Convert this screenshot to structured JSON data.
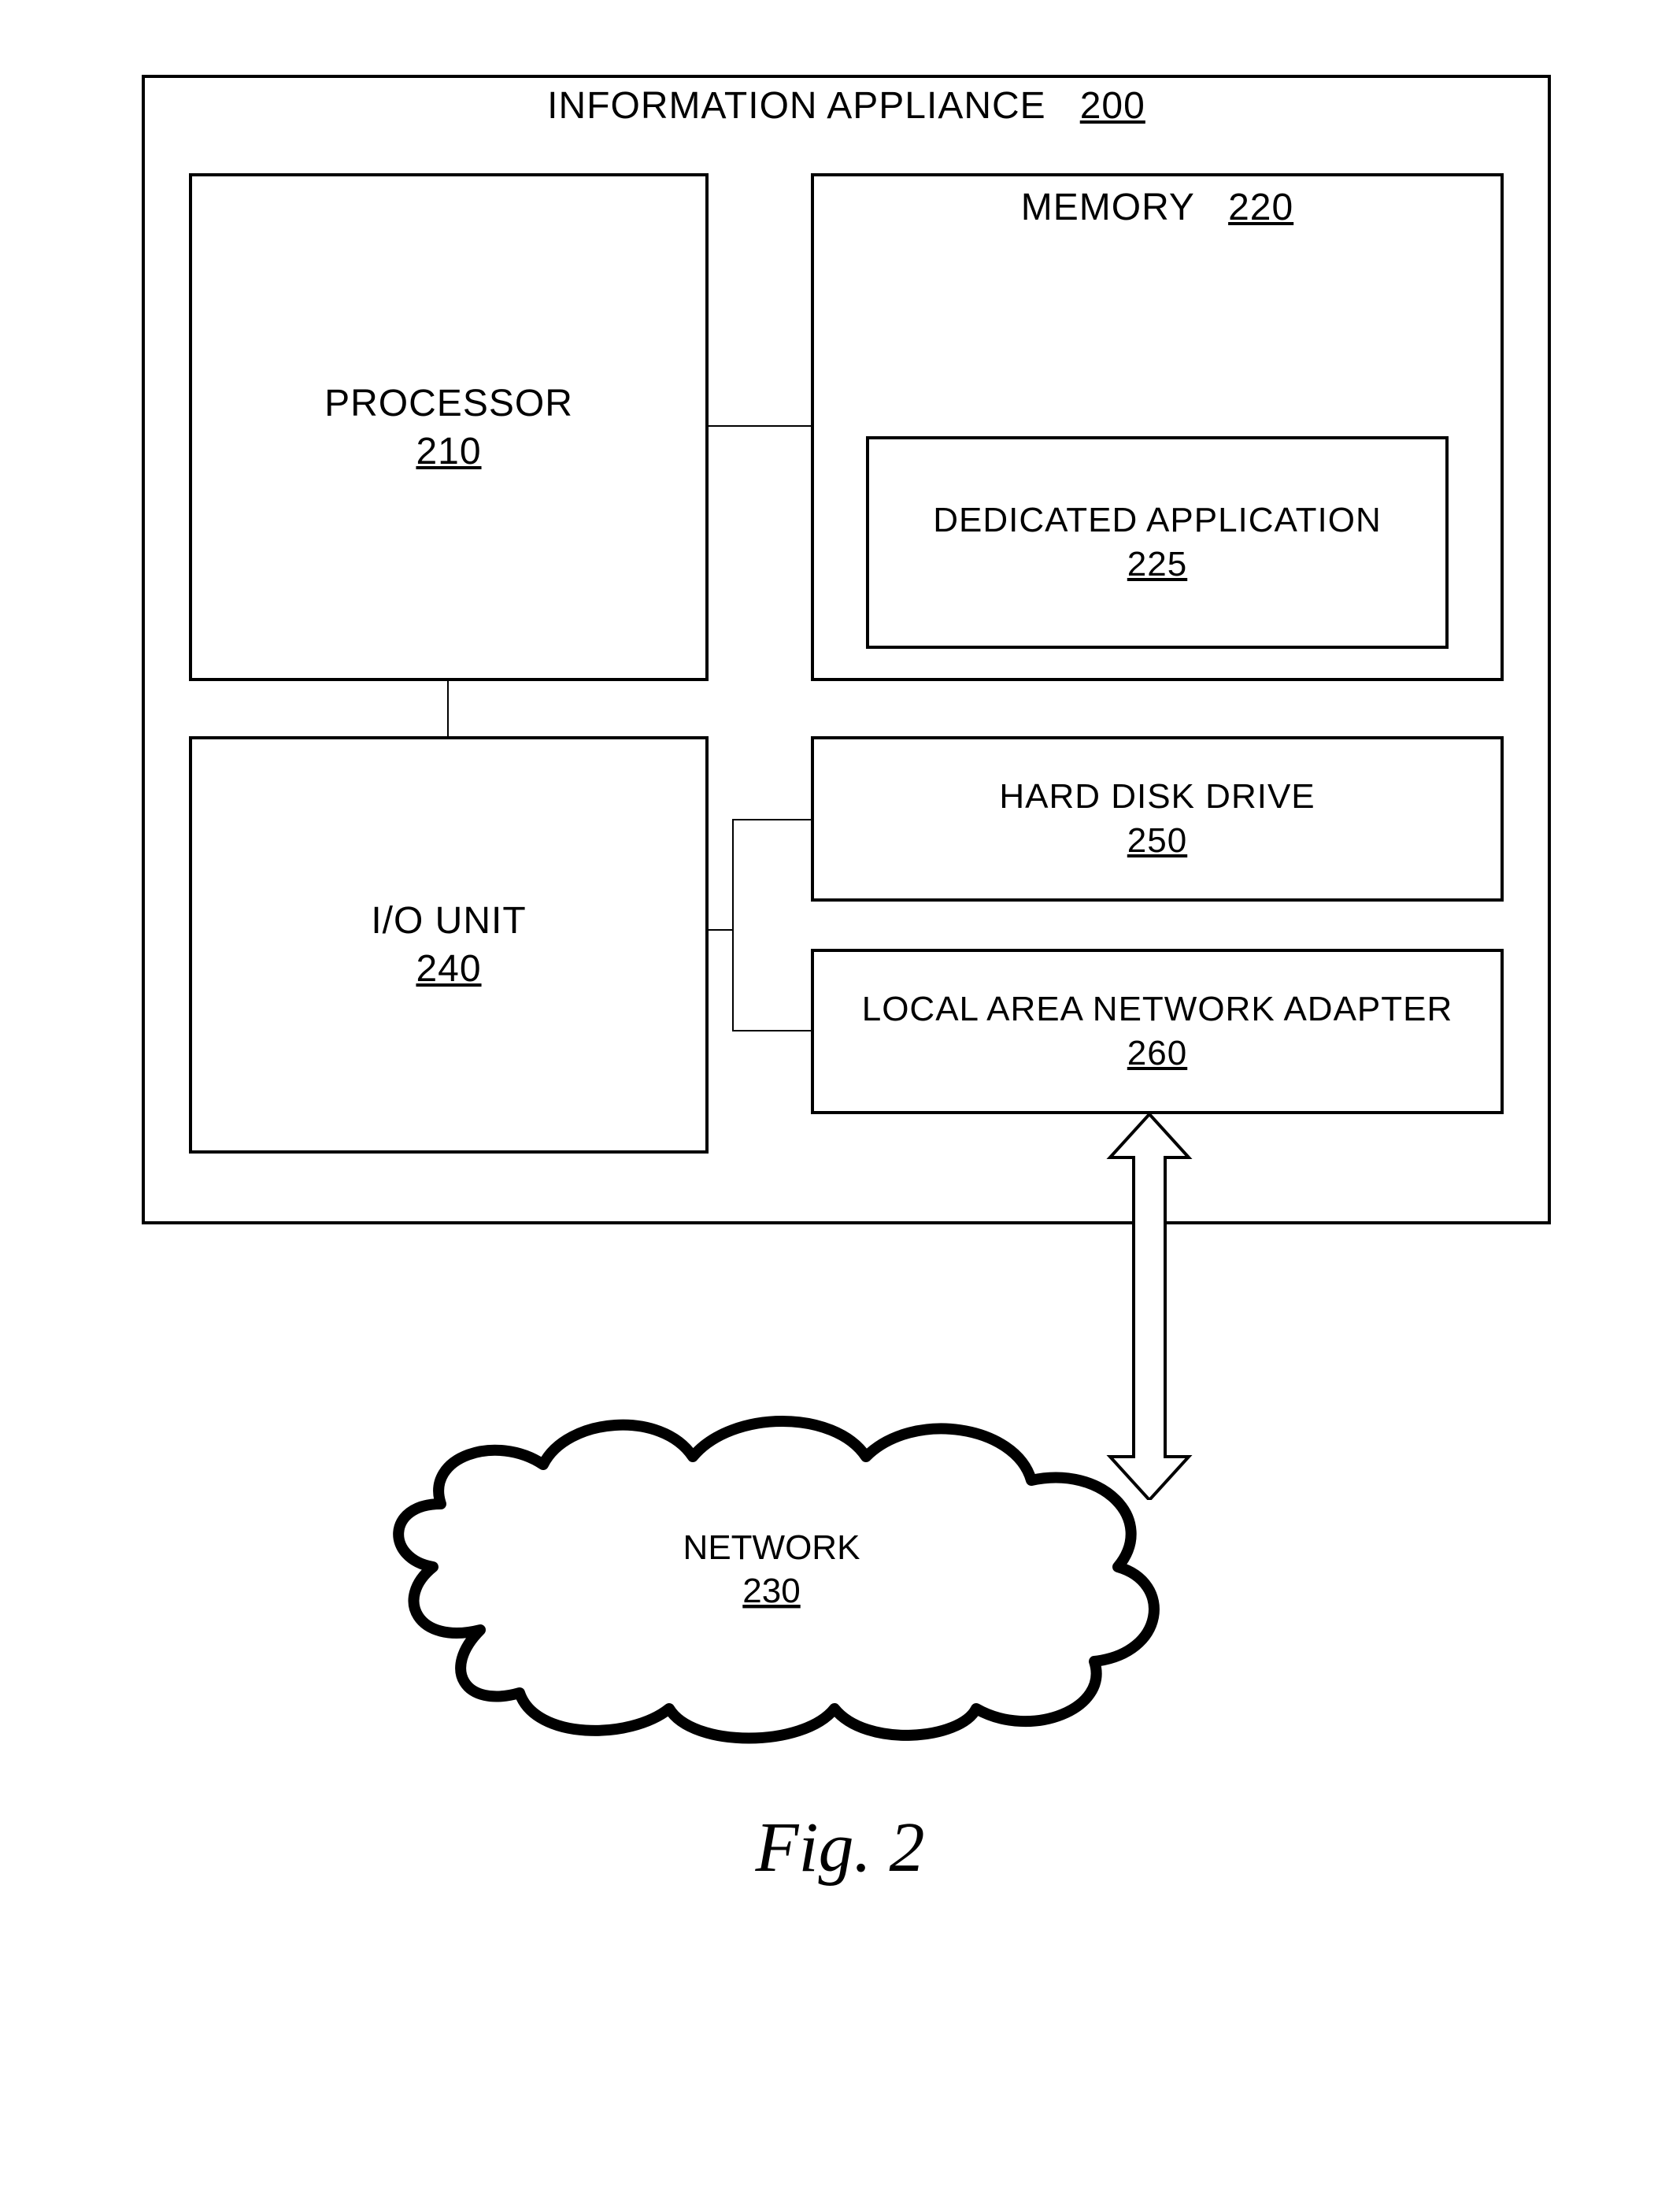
{
  "diagram": {
    "container": {
      "label": "INFORMATION APPLIANCE",
      "ref": "200"
    },
    "processor": {
      "label": "PROCESSOR",
      "ref": "210"
    },
    "memory": {
      "label": "MEMORY",
      "ref": "220"
    },
    "app": {
      "label": "DEDICATED APPLICATION",
      "ref": "225"
    },
    "io": {
      "label": "I/O UNIT",
      "ref": "240"
    },
    "hdd": {
      "label": "HARD DISK DRIVE",
      "ref": "250"
    },
    "lan": {
      "label": "LOCAL AREA NETWORK ADAPTER",
      "ref": "260"
    },
    "network": {
      "label": "NETWORK",
      "ref": "230"
    }
  },
  "caption": "Fig. 2"
}
